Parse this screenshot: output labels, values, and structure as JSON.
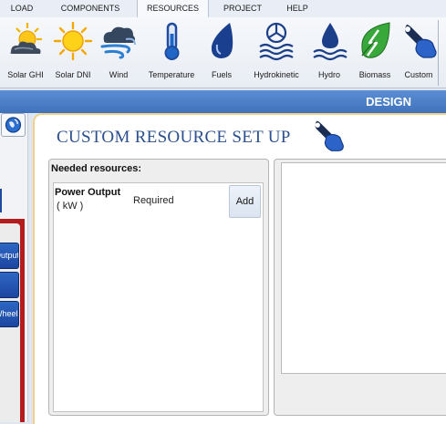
{
  "menu": {
    "items": [
      {
        "label": "LOAD",
        "active": false
      },
      {
        "label": "COMPONENTS",
        "active": false
      },
      {
        "label": "RESOURCES",
        "active": true
      },
      {
        "label": "PROJECT",
        "active": false
      },
      {
        "label": "HELP",
        "active": false
      }
    ]
  },
  "ribbon": {
    "buttons": [
      {
        "label": "Solar GHI",
        "icon": "sun-cloud-icon"
      },
      {
        "label": "Solar DNI",
        "icon": "sun-icon"
      },
      {
        "label": "Wind",
        "icon": "wind-cloud-icon"
      },
      {
        "label": "Temperature",
        "icon": "thermometer-icon"
      },
      {
        "label": "Fuels",
        "icon": "fuel-drop-icon"
      },
      {
        "label": "Hydrokinetic",
        "icon": "hydrokinetic-icon"
      },
      {
        "label": "Hydro",
        "icon": "water-drop-icon"
      },
      {
        "label": "Biomass",
        "icon": "leaf-icon"
      },
      {
        "label": "Custom",
        "icon": "wrench-hand-icon"
      }
    ]
  },
  "design_strip": {
    "label": "DESIGN"
  },
  "left_panel": {
    "buttons": [
      "Output",
      "",
      "Wheel"
    ]
  },
  "main": {
    "title": "CUSTOM RESOURCE SET UP",
    "resources": {
      "heading": "Needed resources:",
      "items": [
        {
          "name": "Power Output",
          "unit": "( kW )",
          "status": "Required",
          "action": "Add"
        }
      ]
    }
  },
  "colors": {
    "accent": "#2b4f8f",
    "design_strip": "#4a7ec8",
    "card_border": "#f1d18a",
    "left_red": "#b31d1d"
  }
}
